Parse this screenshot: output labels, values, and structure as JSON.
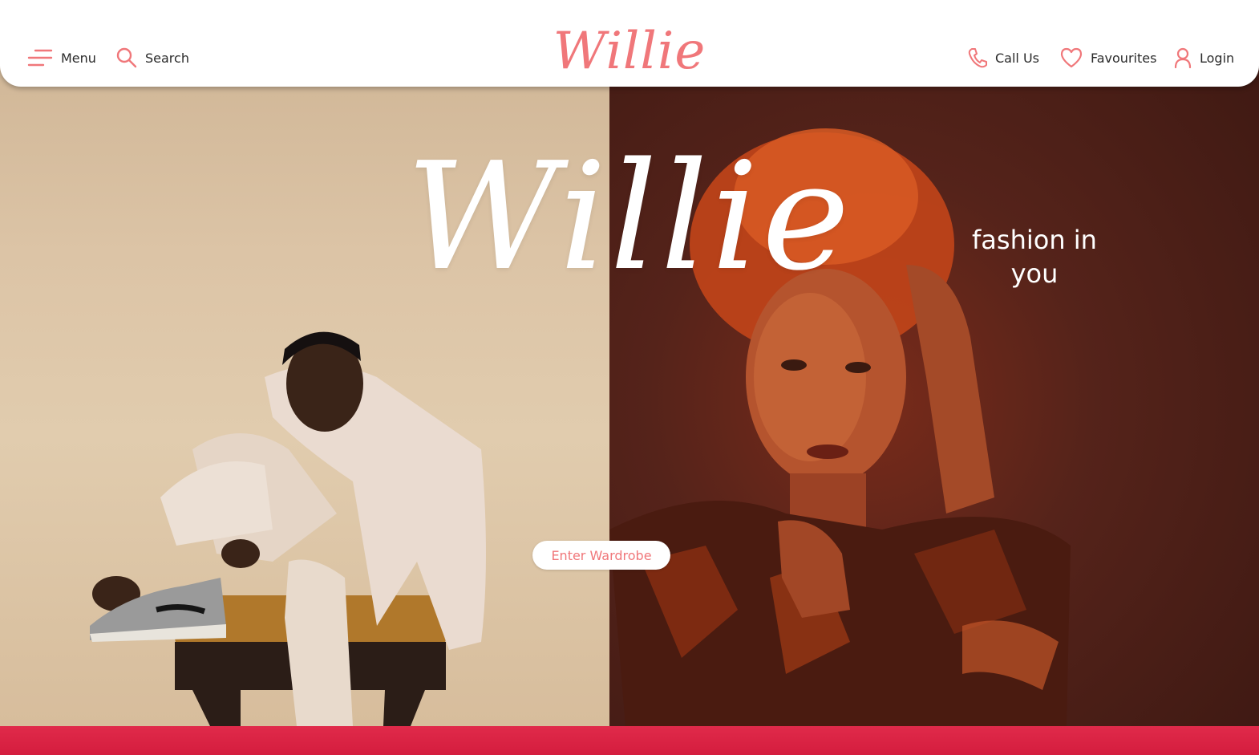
{
  "header": {
    "menu_label": "Menu",
    "search_label": "Search",
    "logo_text": "Willie",
    "call_label": "Call Us",
    "favourites_label": "Favourites",
    "login_label": "Login",
    "icons": [
      "hamburger-menu-icon",
      "search-icon",
      "phone-icon",
      "heart-icon",
      "user-icon"
    ]
  },
  "hero": {
    "logo_text": "Willie",
    "tagline": "fashion in you",
    "cta_label": "Enter Wardrobe"
  },
  "colors": {
    "accent": "#f0777a",
    "bottom_bar": "#d41d3e",
    "left_panel": "#dcc4a6",
    "right_panel": "#55231a"
  }
}
